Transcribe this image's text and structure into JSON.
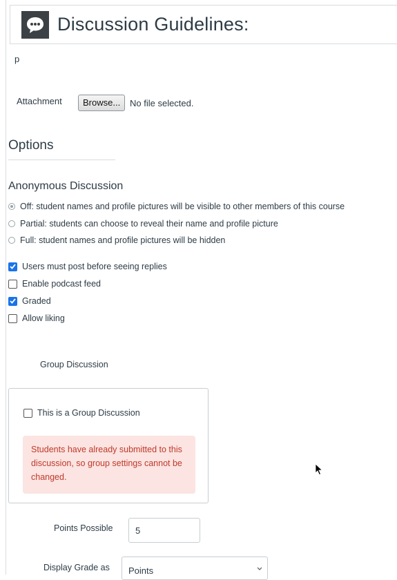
{
  "header": {
    "title": "Discussion Guidelines:",
    "icon": "discussion-icon"
  },
  "body_text": "p",
  "attachment": {
    "label": "Attachment",
    "button": "Browse...",
    "status": "No file selected."
  },
  "options": {
    "title": "Options"
  },
  "anonymous": {
    "title": "Anonymous Discussion",
    "choices": [
      {
        "label": "Off: student names and profile pictures will be visible to other members of this course",
        "selected": true
      },
      {
        "label": "Partial: students can choose to reveal their name and profile picture",
        "selected": false
      },
      {
        "label": "Full: student names and profile pictures will be hidden",
        "selected": false
      }
    ]
  },
  "checks": [
    {
      "label": "Users must post before seeing replies",
      "checked": true
    },
    {
      "label": "Enable podcast feed",
      "checked": false
    },
    {
      "label": "Graded",
      "checked": true
    },
    {
      "label": "Allow liking",
      "checked": false
    }
  ],
  "group": {
    "heading": "Group Discussion",
    "checkbox_label": "This is a Group Discussion",
    "alert": "Students have already submitted to this discussion, so group settings cannot be changed."
  },
  "points": {
    "label": "Points Possible",
    "value": "5"
  },
  "display_grade": {
    "label": "Display Grade as",
    "value": "Points"
  },
  "colors": {
    "accent": "#1a73e8",
    "alert_bg": "#fbe4e1",
    "alert_text": "#c0392b"
  }
}
